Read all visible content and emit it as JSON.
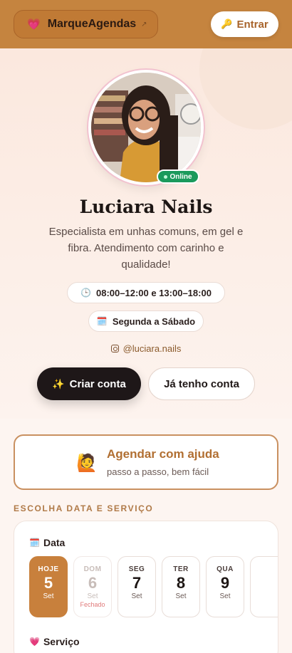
{
  "header": {
    "brand_label": "MarqueAgendas",
    "brand_icon": "heart-icon",
    "external_icon": "arrow-up-right-icon",
    "login_label": "Entrar",
    "login_icon": "key-icon"
  },
  "profile": {
    "name": "Luciara Nails",
    "status": "Online",
    "bio": "Especialista em unhas comuns, em gel e fibra. Atendimento com carinho e qualidade!",
    "hours": "08:00–12:00 e 13:00–18:00",
    "days": "Segunda a Sábado",
    "instagram": "@luciara.nails"
  },
  "actions": {
    "create_account": "Criar conta",
    "have_account": "Já tenho conta"
  },
  "help_card": {
    "title": "Agendar com ajuda",
    "subtitle": "passo a passo, bem fácil"
  },
  "booking": {
    "section_title": "ESCOLHA DATA E SERVIÇO",
    "date_label": "Data",
    "service_label": "Serviço",
    "days": [
      {
        "name": "HOJE",
        "num": "5",
        "month": "Set",
        "note": "",
        "state": "selected"
      },
      {
        "name": "DOM",
        "num": "6",
        "month": "Set",
        "note": "Fechado",
        "state": "closed"
      },
      {
        "name": "SEG",
        "num": "7",
        "month": "Set",
        "note": "",
        "state": "normal"
      },
      {
        "name": "TER",
        "num": "8",
        "month": "Set",
        "note": "",
        "state": "normal"
      },
      {
        "name": "QUA",
        "num": "9",
        "month": "Set",
        "note": "",
        "state": "normal"
      }
    ]
  },
  "colors": {
    "accent": "#c5843f",
    "dark_button": "#1e1718",
    "online": "#1a9a5c"
  }
}
